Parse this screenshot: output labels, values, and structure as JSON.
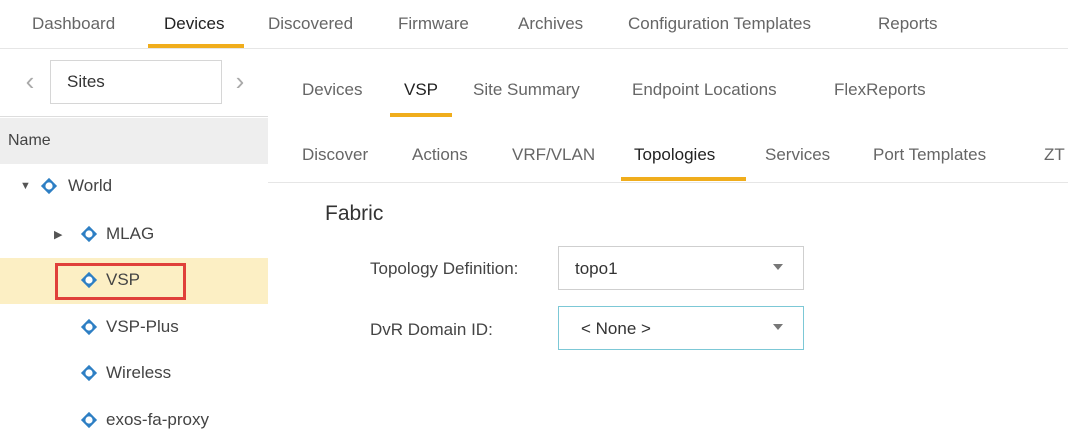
{
  "topnav": {
    "tabs": [
      "Dashboard",
      "Devices",
      "Discovered",
      "Firmware",
      "Archives",
      "Configuration Templates",
      "Reports"
    ],
    "active": "Devices"
  },
  "sidebar": {
    "sites_label": "Sites",
    "name_header": "Name",
    "tree": [
      {
        "label": "World"
      },
      {
        "label": "MLAG"
      },
      {
        "label": "VSP"
      },
      {
        "label": "VSP-Plus"
      },
      {
        "label": "Wireless"
      },
      {
        "label": "exos-fa-proxy"
      }
    ],
    "selected": "VSP"
  },
  "subnav": {
    "tabs": [
      "Devices",
      "VSP",
      "Site Summary",
      "Endpoint Locations",
      "FlexReports"
    ],
    "active": "VSP"
  },
  "subnav2": {
    "tabs": [
      "Discover",
      "Actions",
      "VRF/VLAN",
      "Topologies",
      "Services",
      "Port Templates",
      "ZT"
    ],
    "active": "Topologies"
  },
  "content": {
    "section_title": "Fabric",
    "topology_label": "Topology Definition:",
    "topology_value": "topo1",
    "dvr_label": "DvR Domain ID:",
    "dvr_value": "< None >"
  },
  "colors": {
    "accent": "#f0ad1c",
    "selected_row": "#fcefc4",
    "highlight_box": "#e0403a",
    "node_icon": "#2e7fc4"
  }
}
